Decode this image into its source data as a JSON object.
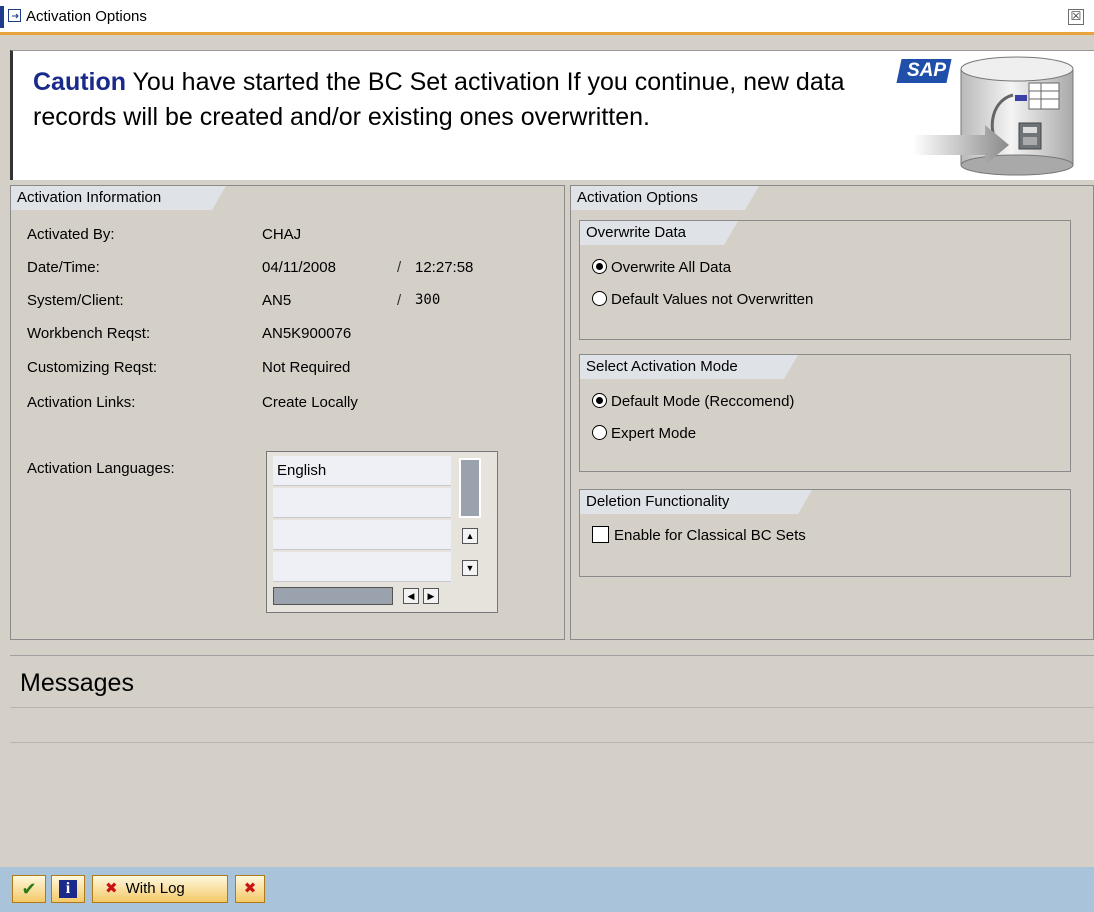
{
  "window": {
    "title": "Activation Options",
    "close_label": "☒"
  },
  "banner": {
    "caution_label": "Caution",
    "message": "You have started the BC Set activation If you continue, new data records will be created and/or existing ones overwritten.",
    "logo_text": "SAP"
  },
  "activation_info": {
    "tab_label": "Activation Information",
    "activated_by": {
      "label": "Activated By:",
      "value": "CHAJ"
    },
    "date_time": {
      "label": "Date/Time:",
      "date": "04/11/2008",
      "separator": "/",
      "time": "12:27:58"
    },
    "system_client": {
      "label": "System/Client:",
      "system": "AN5",
      "separator": "/",
      "client": "300"
    },
    "workbench_reqst": {
      "label": "Workbench Reqst:",
      "value": "AN5K900076"
    },
    "customizing_reqst": {
      "label": "Customizing Reqst:",
      "value": "Not Required"
    },
    "activation_links": {
      "label": "Activation Links:",
      "value": "Create Locally"
    },
    "languages": {
      "label": "Activation Languages:",
      "items": [
        "English",
        "",
        "",
        ""
      ]
    }
  },
  "activation_options": {
    "tab_label": "Activation Options",
    "overwrite_data": {
      "title": "Overwrite Data",
      "options": [
        {
          "label": "Overwrite All Data",
          "selected": true
        },
        {
          "label": "Default Values not Overwritten",
          "selected": false
        }
      ]
    },
    "activation_mode": {
      "title": "Select Activation Mode",
      "options": [
        {
          "label": "Default Mode (Reccomend)",
          "selected": true
        },
        {
          "label": "Expert Mode",
          "selected": false
        }
      ]
    },
    "deletion": {
      "title": "Deletion Functionality",
      "checkbox_label": "Enable for Classical BC Sets",
      "checked": false
    }
  },
  "messages": {
    "title": "Messages"
  },
  "toolbar": {
    "with_log_label": "With Log",
    "check_icon_glyph": "✔",
    "info_icon_glyph": "i",
    "cross_icon_glyph": "✖"
  }
}
